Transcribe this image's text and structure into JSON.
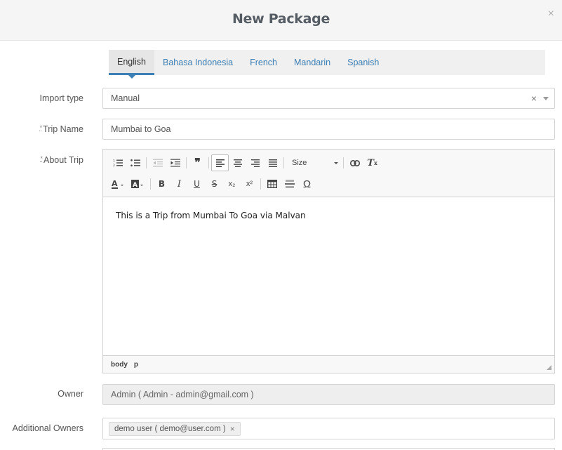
{
  "modal": {
    "title": "New Package",
    "close_glyph": "×"
  },
  "tabs": [
    {
      "label": "English",
      "active": true
    },
    {
      "label": "Bahasa Indonesia"
    },
    {
      "label": "French"
    },
    {
      "label": "Mandarin"
    },
    {
      "label": "Spanish"
    }
  ],
  "form": {
    "import_type": {
      "label": "Import type",
      "value": "Manual",
      "clear_glyph": "×"
    },
    "trip_name": {
      "label": "Trip Name",
      "required_mark": "*",
      "value": "Mumbai to Goa"
    },
    "about_trip": {
      "label": "About Trip",
      "required_mark": "*"
    },
    "owner": {
      "label": "Owner",
      "value": "Admin ( Admin - admin@gmail.com )"
    },
    "additional_owners": {
      "label": "Additional Owners",
      "tags": [
        {
          "text": "demo user ( demo@user.com )",
          "remove_glyph": "×"
        }
      ]
    }
  },
  "editor": {
    "content": "This is a Trip from Mumbai To Goa via Malvan",
    "path": [
      "body",
      "p"
    ],
    "toolbar": {
      "size_label": "Size",
      "glyphs": {
        "blockquote": "❞",
        "bold": "B",
        "italic": "I",
        "underline": "U",
        "strike": "S",
        "subscript": "x₂",
        "superscript": "x²",
        "special_char": "Ω",
        "remove_format": "T"
      }
    }
  },
  "colors": {
    "accent": "#3c7fb5",
    "header_bg": "#f5f5f5",
    "tab_bar_bg": "#f0f0f0",
    "disabled_bg": "#eeeeee"
  }
}
